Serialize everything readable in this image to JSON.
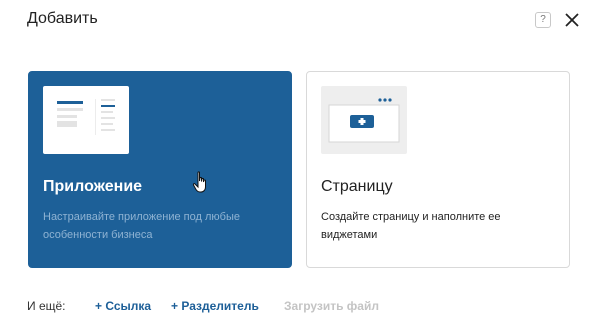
{
  "dialog": {
    "title": "Добавить",
    "help_label": "?"
  },
  "cards": {
    "app": {
      "title": "Приложение",
      "description": "Настраивайте приложение под любые особенности бизнеса"
    },
    "page": {
      "title": "Страницу",
      "description": "Создайте страницу и наполните ее виджетами"
    }
  },
  "footer": {
    "label": "И ещё:",
    "link_label": "+ Ссылка",
    "divider_label": "+ Разделитель",
    "upload_label": "Загрузить файл"
  },
  "colors": {
    "accent": "#1d6098",
    "link": "#1d5f98",
    "disabled": "#c4c4c4"
  }
}
